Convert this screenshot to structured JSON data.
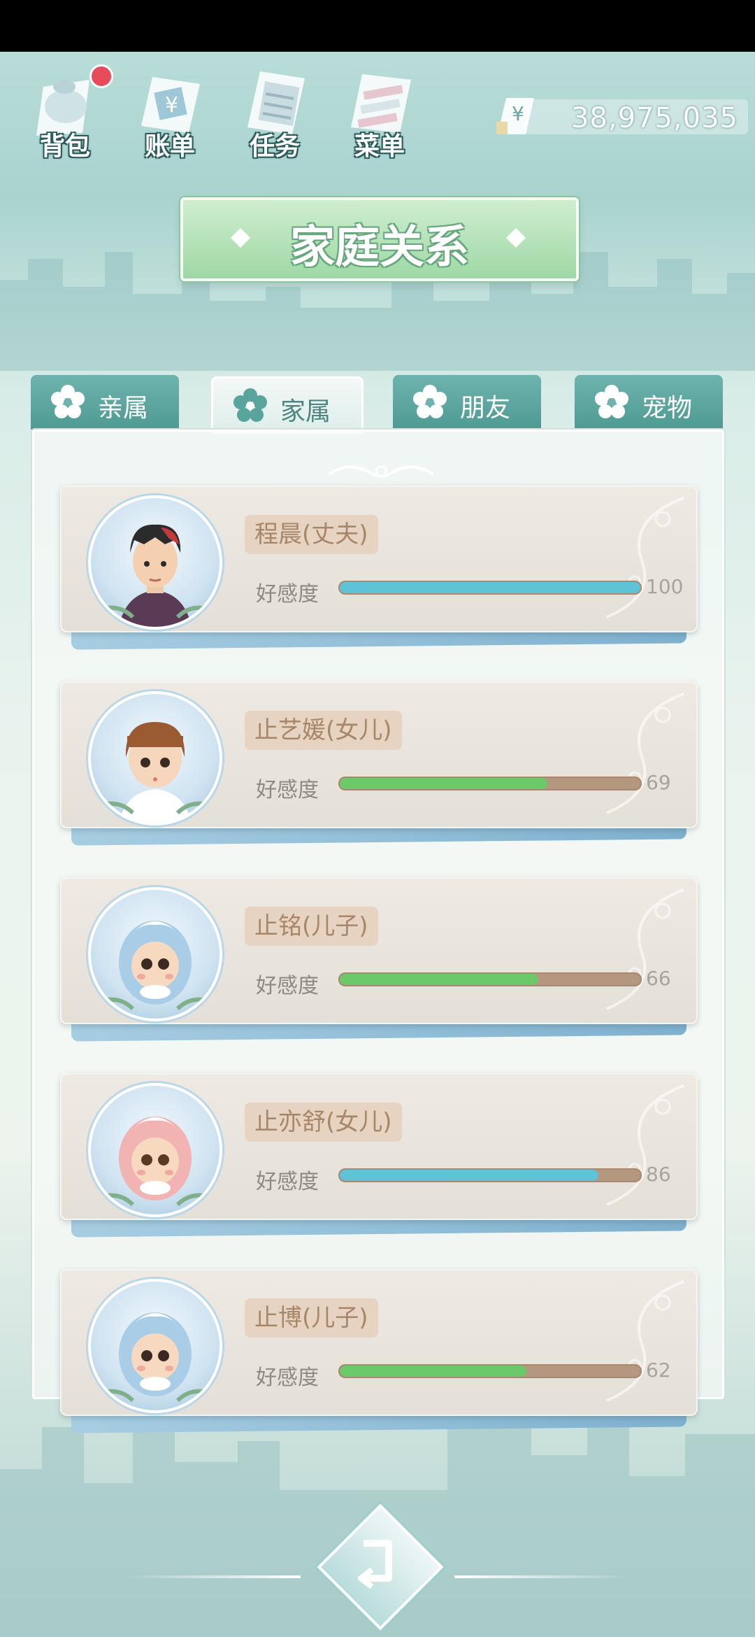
{
  "hud": {
    "bag_label": "背包",
    "bill_label": "账单",
    "task_label": "任务",
    "menu_label": "菜单",
    "currency_symbol": "¥",
    "money": "38,975,035"
  },
  "title": "家庭关系",
  "tabs": [
    {
      "label": "亲属",
      "active": false
    },
    {
      "label": "家属",
      "active": true
    },
    {
      "label": "朋友",
      "active": false
    },
    {
      "label": "宠物",
      "active": false
    }
  ],
  "affinity_label": "好感度",
  "members": [
    {
      "name": "程晨(丈夫)",
      "affinity": 100,
      "affinity_text": "100",
      "bar_color": "#5fc3d8",
      "avatar": "husband-avatar"
    },
    {
      "name": "止艺媛(女儿)",
      "affinity": 69,
      "affinity_text": "69",
      "bar_color": "#6cc96a",
      "avatar": "daughter-avatar"
    },
    {
      "name": "止铭(儿子)",
      "affinity": 66,
      "affinity_text": "66",
      "bar_color": "#6cc96a",
      "avatar": "baby-blue-avatar"
    },
    {
      "name": "止亦舒(女儿)",
      "affinity": 86,
      "affinity_text": "86",
      "bar_color": "#5fc3d8",
      "avatar": "baby-pink-avatar"
    },
    {
      "name": "止博(儿子)",
      "affinity": 62,
      "affinity_text": "62",
      "bar_color": "#6cc96a",
      "avatar": "baby-blue-avatar"
    }
  ],
  "colors": {
    "accent_green": "#9ed8a5",
    "tab_teal": "#5aa49e",
    "bar_track": "#b5967f"
  }
}
